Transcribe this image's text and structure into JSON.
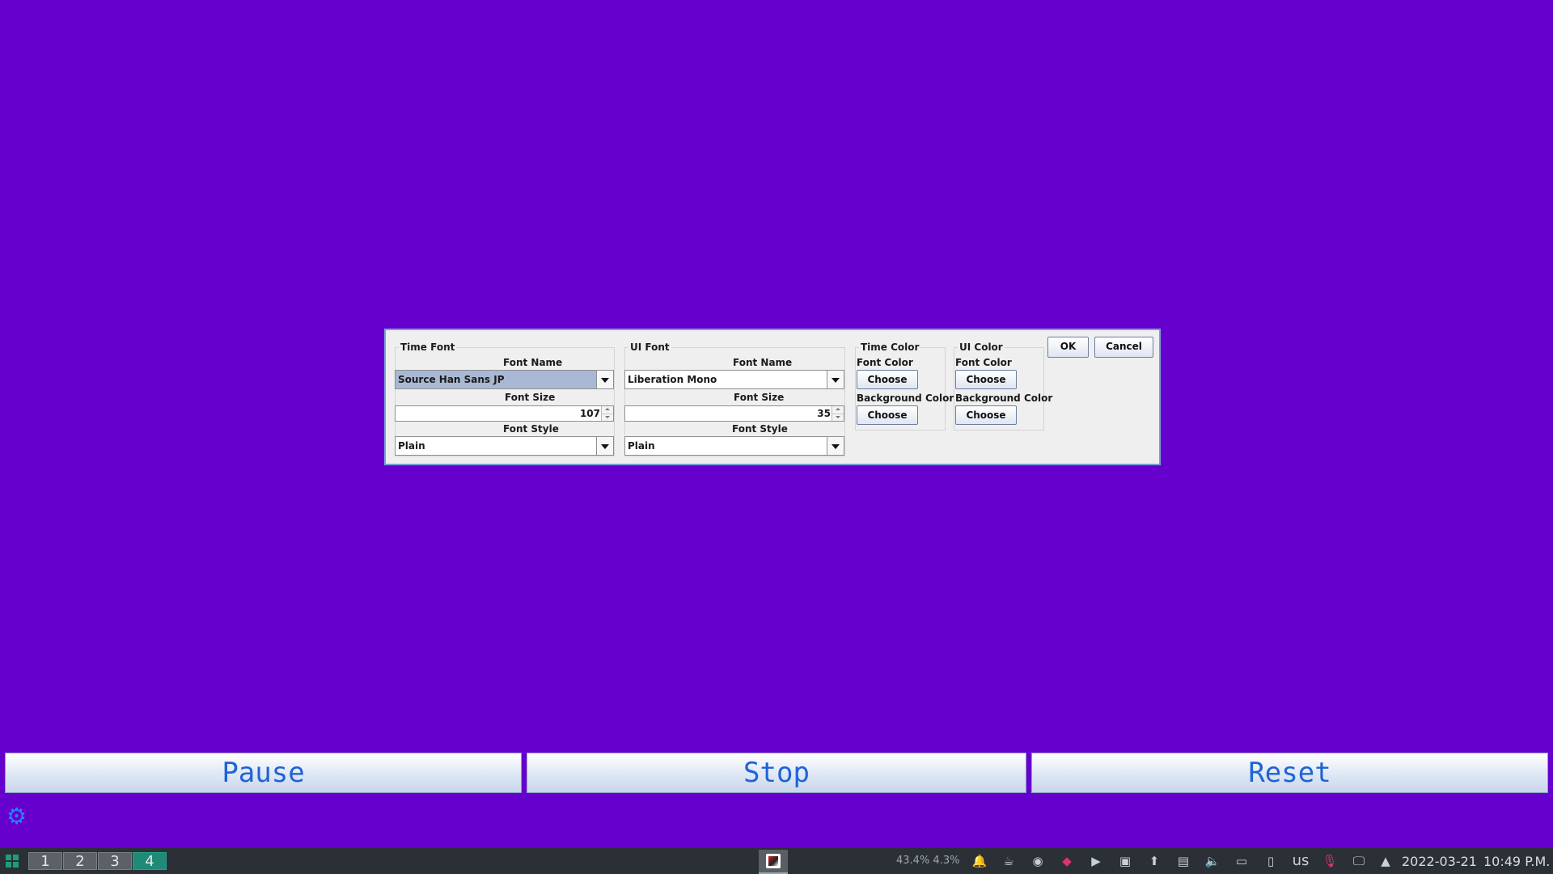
{
  "dialog": {
    "time_font": {
      "title": "Time Font",
      "font_name_label": "Font Name",
      "font_name_value": "Source Han Sans JP",
      "font_size_label": "Font Size",
      "font_size_value": "107",
      "font_style_label": "Font Style",
      "font_style_value": "Plain"
    },
    "ui_font": {
      "title": "UI Font",
      "font_name_label": "Font Name",
      "font_name_value": "Liberation Mono",
      "font_size_label": "Font Size",
      "font_size_value": "35",
      "font_style_label": "Font Style",
      "font_style_value": "Plain"
    },
    "time_color": {
      "title": "Time Color",
      "font_color_label": "Font Color",
      "font_color_button": "Choose",
      "background_color_label": "Background Color",
      "background_color_button": "Choose"
    },
    "ui_color": {
      "title": "UI Color",
      "font_color_label": "Font Color",
      "font_color_button": "Choose",
      "background_color_label": "Background Color",
      "background_color_button": "Choose"
    },
    "ok_label": "OK",
    "cancel_label": "Cancel"
  },
  "controls": {
    "pause_label": "Pause",
    "stop_label": "Stop",
    "reset_label": "Reset",
    "settings_icon": "gear-icon"
  },
  "taskbar": {
    "desktops": [
      "1",
      "2",
      "3",
      "4"
    ],
    "active_desktop": "4",
    "cpu_usage": "43.4% 4.3%",
    "tray_icons": [
      "alarm-icon",
      "coffee-icon",
      "discord-icon",
      "jetbrains-toolbox-icon",
      "media-play-icon",
      "nvidia-icon",
      "updates-icon",
      "clipboard-icon",
      "volume-icon",
      "battery-icon",
      "device-icon",
      "keyboard-layout",
      "microphone-icon",
      "display-icon",
      "tray-expand-icon"
    ],
    "keyboard_layout": "us",
    "date": "2022-03-21",
    "time": "10:49 P.M."
  },
  "colors": {
    "background": "#6600cc",
    "button_text": "#1f63d6",
    "active_desktop": "#1f8a78"
  }
}
